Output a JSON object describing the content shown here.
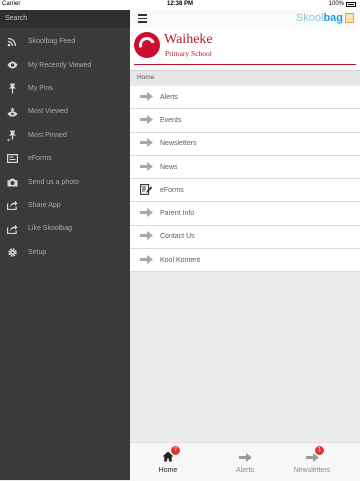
{
  "status_bar": {
    "carrier": "Carrier",
    "time": "12:38 PM",
    "battery": "100%"
  },
  "sidebar": {
    "search_label": "Search",
    "items": [
      {
        "label": "Skoolbag Feed",
        "icon": "rss-icon"
      },
      {
        "label": "My Recently Viewed",
        "icon": "eye-icon"
      },
      {
        "label": "My Pins",
        "icon": "pin-icon"
      },
      {
        "label": "Most Viewed",
        "icon": "eye-star-icon"
      },
      {
        "label": "Most Pinned",
        "icon": "pin-star-icon"
      },
      {
        "label": "eForms",
        "icon": "form-icon"
      },
      {
        "label": "Send us a photo",
        "icon": "camera-icon"
      },
      {
        "label": "Share App",
        "icon": "share-icon"
      },
      {
        "label": "Like Skoolbag",
        "icon": "like-icon"
      },
      {
        "label": "Setup",
        "icon": "gear-icon"
      }
    ]
  },
  "header": {
    "brand_prefix": "Skool",
    "brand_suffix": "bag"
  },
  "school": {
    "name_line1": "Waiheke",
    "name_line2": "Primary School"
  },
  "breadcrumb": "Home",
  "menu": [
    {
      "label": "Alerts",
      "icon": "arrow-right-icon"
    },
    {
      "label": "Events",
      "icon": "arrow-right-icon"
    },
    {
      "label": "Newsletters",
      "icon": "arrow-right-icon"
    },
    {
      "label": "News",
      "icon": "arrow-right-icon"
    },
    {
      "label": "eForms",
      "icon": "form-edit-icon"
    },
    {
      "label": "Parent Info",
      "icon": "arrow-right-icon"
    },
    {
      "label": "Contact Us",
      "icon": "arrow-right-icon"
    },
    {
      "label": "Kool Kontent",
      "icon": "arrow-right-icon"
    }
  ],
  "tabs": [
    {
      "label": "Home",
      "icon": "home-icon",
      "badge": "7",
      "active": true
    },
    {
      "label": "Alerts",
      "icon": "arrow-right-icon",
      "badge": "",
      "active": false
    },
    {
      "label": "Newsletters",
      "icon": "arrow-right-icon",
      "badge": "1",
      "active": false
    }
  ],
  "colors": {
    "sidebar_bg": "#3a3a3a",
    "accent_red": "#c8102e",
    "brand_blue": "#1f9fd2",
    "badge_red": "#e3342f"
  }
}
